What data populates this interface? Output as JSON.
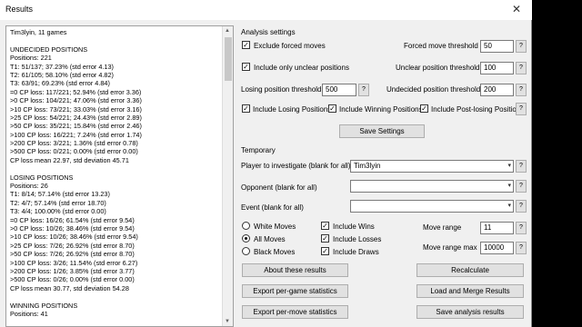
{
  "window": {
    "title": "Results",
    "close_glyph": "✕"
  },
  "results": {
    "lines": [
      "Tim3lyin, 11 games",
      "",
      "UNDECIDED POSITIONS",
      "Positions: 221",
      "T1: 51/137; 37.23% (std error 4.13)",
      "T2: 61/105; 58.10% (std error 4.82)",
      "T3: 63/91; 69.23% (std error 4.84)",
      "=0 CP loss: 117/221; 52.94% (std error 3.36)",
      ">0 CP loss: 104/221; 47.06% (std error 3.36)",
      ">10 CP loss: 73/221; 33.03% (std error 3.16)",
      ">25 CP loss: 54/221; 24.43% (std error 2.89)",
      ">50 CP loss: 35/221; 15.84% (std error 2.46)",
      ">100 CP loss: 16/221; 7.24% (std error 1.74)",
      ">200 CP loss: 3/221; 1.36% (std error 0.78)",
      ">500 CP loss: 0/221; 0.00% (std error 0.00)",
      "CP loss mean 22.97, std deviation 45.71",
      "",
      "LOSING POSITIONS",
      "Positions: 26",
      "T1: 8/14; 57.14% (std error 13.23)",
      "T2: 4/7; 57.14% (std error 18.70)",
      "T3: 4/4; 100.00% (std error 0.00)",
      "=0 CP loss: 16/26; 61.54% (std error 9.54)",
      ">0 CP loss: 10/26; 38.46% (std error 9.54)",
      ">10 CP loss: 10/26; 38.46% (std error 9.54)",
      ">25 CP loss: 7/26; 26.92% (std error 8.70)",
      ">50 CP loss: 7/26; 26.92% (std error 8.70)",
      ">100 CP loss: 3/26; 11.54% (std error 6.27)",
      ">200 CP loss: 1/26; 3.85% (std error 3.77)",
      ">500 CP loss: 0/26; 0.00% (std error 0.00)",
      "CP loss mean 30.77, std deviation 54.28",
      "",
      "WINNING POSITIONS",
      "Positions: 41"
    ]
  },
  "analysis": {
    "heading": "Analysis settings",
    "exclude_forced_label": "Exclude forced moves",
    "exclude_forced_checked": "✓",
    "forced_threshold_label": "Forced move threshold",
    "forced_threshold_value": "50",
    "only_unclear_label": "Include only unclear positions",
    "only_unclear_checked": "✓",
    "unclear_threshold_label": "Unclear position threshold",
    "unclear_threshold_value": "100",
    "losing_threshold_label": "Losing position threshold",
    "losing_threshold_value": "500",
    "undecided_threshold_label": "Undecided position threshold",
    "undecided_threshold_value": "200",
    "include_losing_label": "Include Losing Positions",
    "include_winning_label": "Include Winning Positions",
    "include_postlosing_label": "Include Post-losing Positions",
    "checked_glyph": "✓",
    "help_glyph": "?",
    "save_settings_label": "Save Settings"
  },
  "temporary": {
    "heading": "Temporary",
    "player_label": "Player to investigate (blank for all)",
    "player_value": "Tim3lyin",
    "opponent_label": "Opponent (blank for all)",
    "opponent_value": "",
    "event_label": "Event (blank for all)",
    "event_value": "",
    "dropdown_glyph": "▾",
    "white_moves_label": "White Moves",
    "all_moves_label": "All Moves",
    "black_moves_label": "Black Moves",
    "include_wins_label": "Include Wins",
    "include_losses_label": "Include Losses",
    "include_draws_label": "Include Draws",
    "move_range_label": "Move range",
    "move_range_value": "11",
    "move_range_max_label": "Move range max",
    "move_range_max_value": "10000"
  },
  "buttons": {
    "about": "About these results",
    "recalculate": "Recalculate",
    "export_game": "Export per-game statistics",
    "load_merge": "Load and Merge Results",
    "export_move": "Export per-move statistics",
    "save_analysis": "Save analysis results"
  },
  "scrollbar": {
    "up_glyph": "▲",
    "down_glyph": "▼"
  }
}
